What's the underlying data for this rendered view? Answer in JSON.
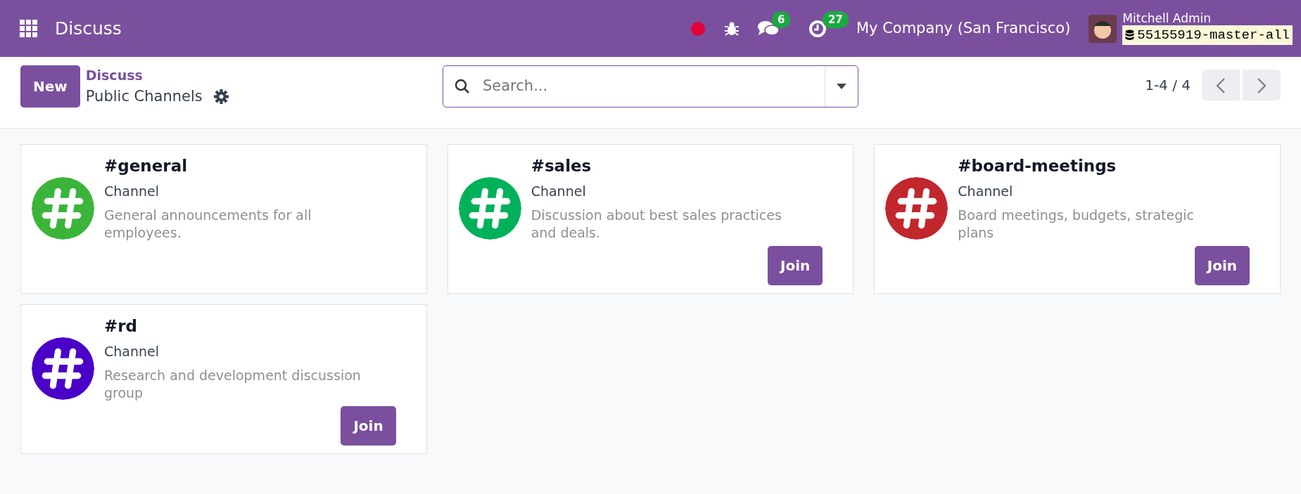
{
  "navbar": {
    "app_name": "Discuss",
    "messages_count": "6",
    "activities_count": "27",
    "company": "My Company (San Francisco)",
    "user": "Mitchell Admin",
    "database": "55155919-master-all"
  },
  "control_panel": {
    "new_button": "New",
    "breadcrumb": "Discuss",
    "title": "Public Channels",
    "search": {
      "placeholder": "Search..."
    },
    "pager": "1-4 / 4"
  },
  "channels": [
    {
      "name": "#general",
      "type": "Channel",
      "description": "General announcements for all employees.",
      "color": "#3ab53a"
    },
    {
      "name": "#sales",
      "type": "Channel",
      "description": "Discussion about best sales practices and deals.",
      "color": "#00b15a",
      "action": "Join"
    },
    {
      "name": "#board-meetings",
      "type": "Channel",
      "description": "Board meetings, budgets, strategic plans",
      "color": "#c1272d",
      "action": "Join"
    },
    {
      "name": "#rd",
      "type": "Channel",
      "description": "Research and development discussion group",
      "color": "#4b00c8",
      "action": "Join"
    }
  ]
}
